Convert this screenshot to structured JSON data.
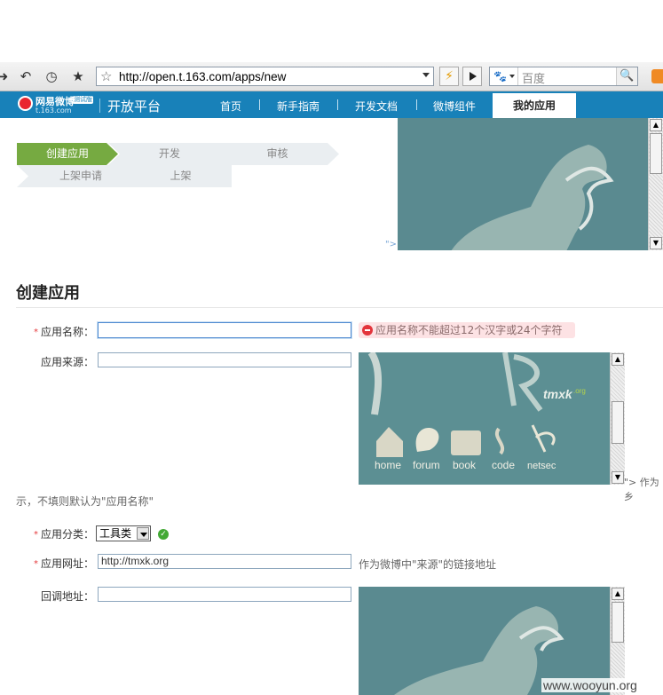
{
  "browser": {
    "url": "http://open.t.163.com/apps/new",
    "search_placeholder": "百度",
    "icons": [
      "back-icon",
      "reload-icon",
      "history-icon",
      "bookmark-star-icon",
      "lightning-icon",
      "go-icon",
      "search-engine-icon",
      "magnifier-icon",
      "rss-icon"
    ]
  },
  "header": {
    "logo_text": "网易微博",
    "logo_badge": "测试版",
    "logo_sub": "t.163.com",
    "platform_title": "开放平台",
    "nav": [
      "首页",
      "新手指南",
      "开发文档",
      "微博组件"
    ],
    "nav_active": "我的应用",
    "brand_color": "#1881b9"
  },
  "steps": {
    "row1": [
      "创建应用",
      "开发",
      "审核"
    ],
    "row2": [
      "上架申请",
      "上架"
    ],
    "active_color": "#76aa41"
  },
  "frame_residue": "\">",
  "form": {
    "title": "创建应用",
    "app_name_label": "应用名称：",
    "app_name_value": "",
    "app_name_error": "应用名称不能超过12个汉字或24个字符",
    "app_source_label": "应用来源：",
    "app_source_value": "",
    "source_hint_right": "\"> 作为乡",
    "source_hint_wrap": "示，不填则默认为\"应用名称\"",
    "category_label": "应用分类：",
    "category_value": "工具类",
    "url_label": "应用网址：",
    "url_value": "http://tmxk.org",
    "url_hint": "作为微博中\"来源\"的链接地址",
    "callback_label": "回调地址：",
    "callback_value": ""
  },
  "embedded_site": {
    "logo": "tmxk",
    "logo_suffix": ".org",
    "links": [
      "home",
      "forum",
      "book",
      "code",
      "netsec"
    ]
  },
  "watermark": "www.wooyun.org"
}
